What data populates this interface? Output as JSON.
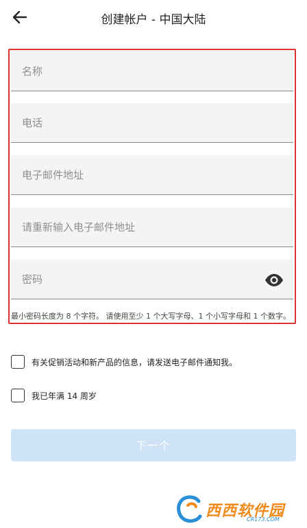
{
  "header": {
    "title": "创建帐户 - 中国大陆",
    "back_icon": "arrow-left-icon"
  },
  "form": {
    "name_placeholder": "名称",
    "phone_placeholder": "电话",
    "email_placeholder": "电子邮件地址",
    "email_confirm_placeholder": "请重新输入电子邮件地址",
    "password_placeholder": "密码",
    "password_toggle_icon": "eye-icon",
    "password_hint": "最小密码长度为 8 个字符。 请使用至少 1 个大写字母、1 个小写字母和 1 个数字。"
  },
  "options": {
    "marketing_label": "有关促销活动和新产品的信息，请发送电子邮件通知我。",
    "age_label": "我已年满 14 周岁"
  },
  "actions": {
    "next_label": "下一个"
  },
  "watermark": {
    "text": "西西软件园",
    "sub": "CR173.COM"
  },
  "colors": {
    "highlight_border": "#e03030",
    "next_button_bg": "#cfe3f6",
    "field_bg": "#f4f4f4"
  }
}
